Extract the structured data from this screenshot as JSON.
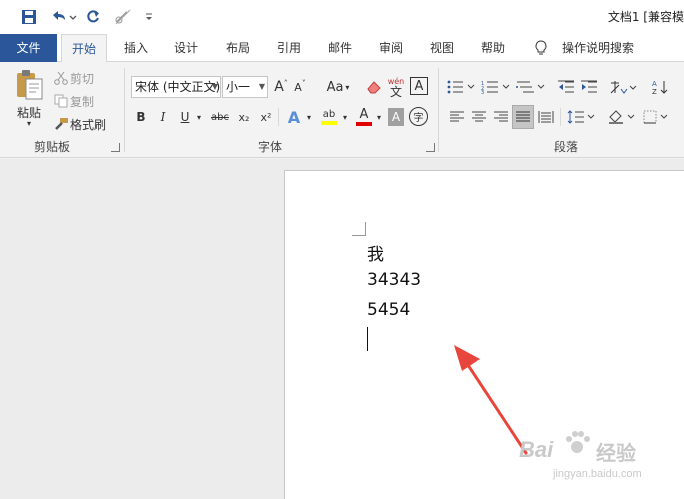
{
  "title_bar": {
    "doc_title": "文档1 [兼容模"
  },
  "tabs": [
    {
      "label": "文件"
    },
    {
      "label": "开始"
    },
    {
      "label": "插入"
    },
    {
      "label": "设计"
    },
    {
      "label": "布局"
    },
    {
      "label": "引用"
    },
    {
      "label": "邮件"
    },
    {
      "label": "审阅"
    },
    {
      "label": "视图"
    },
    {
      "label": "帮助"
    },
    {
      "label": "操作说明搜索"
    }
  ],
  "clipboard": {
    "paste": "粘贴",
    "cut": "剪切",
    "copy": "复制",
    "format_painter": "格式刷",
    "group_label": "剪贴板"
  },
  "font": {
    "font_name": "宋体 (中文正文)",
    "font_size": "小一",
    "grow": "A",
    "shrink": "A",
    "change_case": "Aa",
    "phonetic_top": "wén",
    "phonetic_bottom": "文",
    "char_border": "A",
    "bold": "B",
    "italic": "I",
    "underline": "U",
    "strike": "abc",
    "subscript": "x₂",
    "superscript": "x²",
    "text_effects": "A",
    "highlight": "ab",
    "font_color": "A",
    "char_shading": "A",
    "enclose": "字",
    "group_label": "字体",
    "highlight_color": "#ffff00",
    "font_color_value": "#e00000"
  },
  "paragraph": {
    "group_label": "段落"
  },
  "document": {
    "lines": [
      "我",
      "34343",
      "5454"
    ]
  },
  "watermark": {
    "logo": "Bai",
    "logo_cn": "经验",
    "url": "jingyan.baidu.com"
  },
  "colors": {
    "accent": "#2b579a",
    "arrow": "#e8463c"
  }
}
